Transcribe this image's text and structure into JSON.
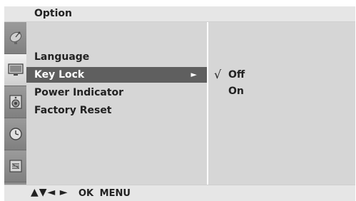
{
  "header": {
    "title": "Option"
  },
  "sidebar": {
    "icons": [
      {
        "name": "satellite-dish-icon",
        "active": false
      },
      {
        "name": "tv-screen-icon",
        "active": true
      },
      {
        "name": "speaker-icon",
        "active": false
      },
      {
        "name": "clock-icon",
        "active": false
      },
      {
        "name": "option-icon",
        "active": false
      }
    ]
  },
  "menu": {
    "items": [
      {
        "label": "Language",
        "selected": false
      },
      {
        "label": "Key Lock",
        "selected": true
      },
      {
        "label": "Power Indicator",
        "selected": false
      },
      {
        "label": "Factory Reset",
        "selected": false
      }
    ],
    "arrow_glyph": "►"
  },
  "submenu": {
    "check_glyph": "√",
    "options": [
      {
        "label": "Off",
        "checked": true
      },
      {
        "label": "On",
        "checked": false
      }
    ]
  },
  "footer": {
    "nav_glyphs": "▲▼◄ ►",
    "nav_text": "OK MENU"
  },
  "colors": {
    "selected_bg": "#5f5f5f",
    "panel_bg": "#d6d6d6",
    "icon_strip": "#8f8f8f"
  }
}
